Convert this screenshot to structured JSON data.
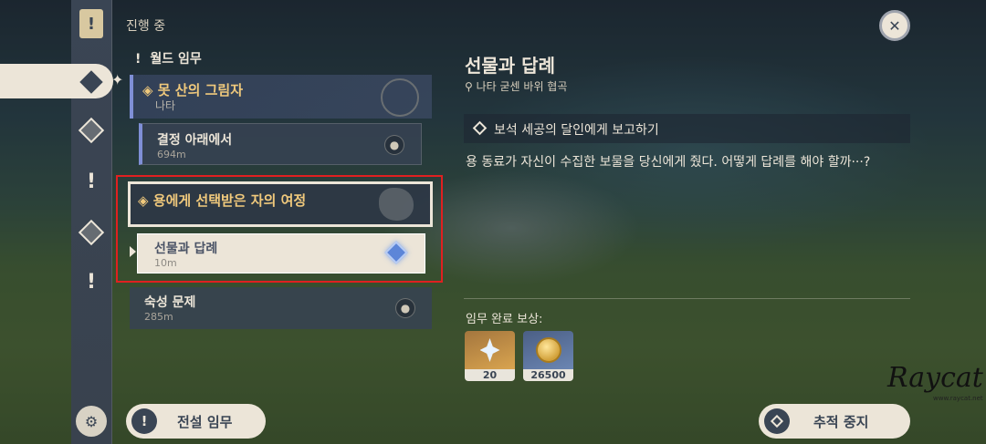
{
  "header": {
    "status": "진행 중",
    "group_label": "월드 임무",
    "close_icon": "close-icon"
  },
  "quests": {
    "parent": {
      "title": "못 산의 그림자",
      "subtitle": "나타"
    },
    "sub_quest": {
      "title": "결정 아래에서",
      "distance": "694m"
    },
    "featured": {
      "title": "용에게 선택받은 자의 여정"
    },
    "selected": {
      "title": "선물과 답례",
      "distance": "10m"
    },
    "other": {
      "title": "숙성 문제",
      "distance": "285m"
    }
  },
  "legend_button": {
    "label": "전설 임무"
  },
  "detail": {
    "title": "선물과 답례",
    "location": "나타 굳센 바위 협곡",
    "objective": "보석 세공의 달인에게 보고하기",
    "description": "용 동료가 자신이 수집한 보물을 당신에게 줬다. 어떻게 답례를 해야 할까···?",
    "reward_label": "임무 완료 보상:",
    "rewards": [
      {
        "icon": "primogem-icon",
        "count": "20"
      },
      {
        "icon": "mora-coin-icon",
        "count": "26500"
      }
    ]
  },
  "track_button": {
    "label": "추적 중지"
  },
  "watermark": {
    "main": "Raycat",
    "sub": "www.raycat.net"
  },
  "colors": {
    "accent": "#f0c97c",
    "panel": "#3a4554",
    "cream": "#ece5d8",
    "highlight": "#e02020"
  }
}
